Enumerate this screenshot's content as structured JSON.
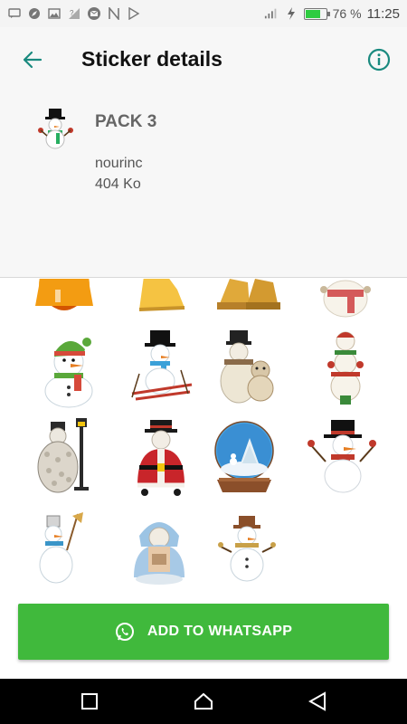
{
  "status_bar": {
    "battery_percent": "76 %",
    "battery_level": 0.76,
    "time": "11:25",
    "icons": [
      "message-icon",
      "compass-icon",
      "image-icon",
      "signal-question-icon",
      "email-icon",
      "n-icon",
      "play-store-icon",
      "signal-icon",
      "charging-icon"
    ]
  },
  "app_bar": {
    "title": "Sticker details",
    "back_icon": "arrow-left-icon",
    "info_icon": "info-icon"
  },
  "pack": {
    "name": "PACK 3",
    "author": "nourinc",
    "size": "404 Ko"
  },
  "stickers": [
    {
      "name": "orange-bell-sticker"
    },
    {
      "name": "gold-bell-sticker"
    },
    {
      "name": "double-bells-sticker"
    },
    {
      "name": "snowman-scarf-partial-sticker"
    },
    {
      "name": "snowman-green-hat-sticker"
    },
    {
      "name": "snowman-skiing-sticker"
    },
    {
      "name": "snowman-with-bear-sticker"
    },
    {
      "name": "snowman-stacked-sticker"
    },
    {
      "name": "snowman-lamp-post-sticker"
    },
    {
      "name": "snowman-santa-coat-sticker"
    },
    {
      "name": "snow-globe-sticker"
    },
    {
      "name": "snowman-waving-sticker"
    },
    {
      "name": "snowman-broom-sticker"
    },
    {
      "name": "snowman-blue-hood-sticker"
    },
    {
      "name": "snowman-brown-hat-sticker"
    }
  ],
  "add_button": {
    "label": "ADD TO WHATSAPP",
    "color": "#40b93c"
  },
  "accent_color": "#1a8a7f"
}
